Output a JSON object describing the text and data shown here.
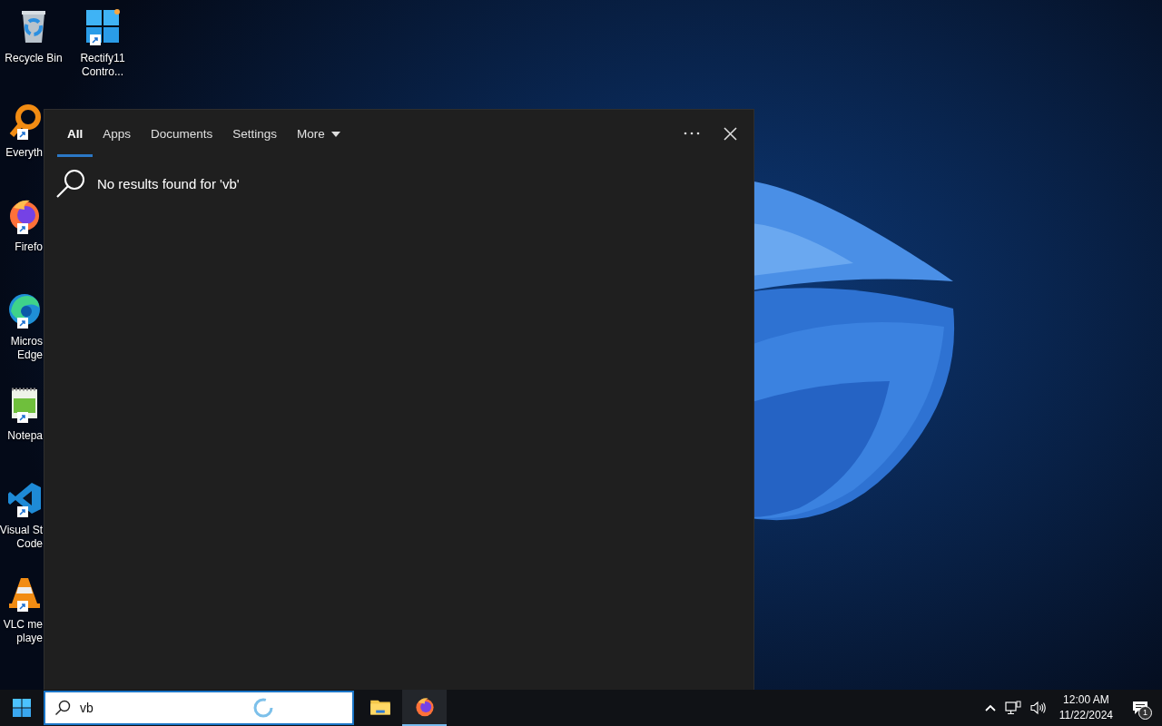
{
  "desktop": {
    "icons": [
      {
        "kind": "recycle",
        "lines": [
          "Recycle Bin"
        ]
      },
      {
        "kind": "tiles",
        "lines": [
          "Rectify11",
          "Contro..."
        ]
      },
      {
        "kind": "search",
        "lines": [
          "Everyth"
        ]
      },
      {
        "kind": "firefox",
        "lines": [
          "Firefo"
        ]
      },
      {
        "kind": "edge",
        "lines": [
          "Micros",
          "Edge"
        ]
      },
      {
        "kind": "notepad",
        "lines": [
          "Notepa"
        ]
      },
      {
        "kind": "vscode",
        "lines": [
          "Visual St",
          "Code"
        ]
      },
      {
        "kind": "vlc",
        "lines": [
          "VLC me",
          "playe"
        ]
      }
    ]
  },
  "search_panel": {
    "tabs": [
      {
        "label": "All",
        "selected": true,
        "dropdown": false
      },
      {
        "label": "Apps",
        "selected": false,
        "dropdown": false
      },
      {
        "label": "Documents",
        "selected": false,
        "dropdown": false
      },
      {
        "label": "Settings",
        "selected": false,
        "dropdown": false
      },
      {
        "label": "More",
        "selected": false,
        "dropdown": true
      }
    ],
    "message": "No results found for 'vb'"
  },
  "taskbar": {
    "search": {
      "value": "vb",
      "loading": true
    },
    "apps": [
      {
        "kind": "folder",
        "selected": false
      },
      {
        "kind": "firefox",
        "selected": true
      }
    ],
    "clock": {
      "time": "12:00 AM",
      "date": "11/22/2024"
    },
    "notifications": "1"
  }
}
